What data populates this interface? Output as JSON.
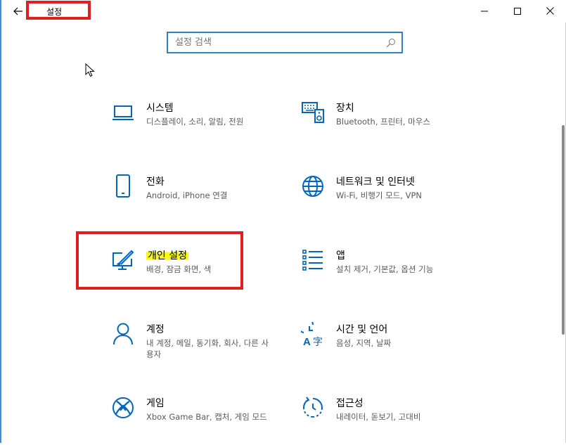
{
  "window": {
    "title": "설정",
    "minimize_label": "Minimize",
    "maximize_label": "Maximize",
    "close_label": "Close"
  },
  "search": {
    "placeholder": "설정 검색"
  },
  "colors": {
    "accent": "#0067c0",
    "annotation_red": "#e02020",
    "highlight_yellow": "#f7f71a"
  },
  "tiles": [
    {
      "id": "system",
      "title": "시스템",
      "desc": "디스플레이, 소리, 알림, 전원",
      "icon": "laptop-icon"
    },
    {
      "id": "devices",
      "title": "장치",
      "desc": "Bluetooth, 프린터, 마우스",
      "icon": "keyboard-speaker-icon"
    },
    {
      "id": "phone",
      "title": "전화",
      "desc": "Android, iPhone 연결",
      "icon": "phone-icon"
    },
    {
      "id": "network",
      "title": "네트워크 및 인터넷",
      "desc": "Wi-Fi, 비행기 모드, VPN",
      "icon": "globe-icon"
    },
    {
      "id": "personalization",
      "title": "개인 설정",
      "desc": "배경, 잠금 화면, 색",
      "icon": "paint-screen-icon"
    },
    {
      "id": "apps",
      "title": "앱",
      "desc": "설치 제거, 기본값, 옵션 기능",
      "icon": "app-list-icon"
    },
    {
      "id": "accounts",
      "title": "계정",
      "desc": "내 계정, 메일, 동기화, 회사, 다른 사용자",
      "icon": "person-icon"
    },
    {
      "id": "time-language",
      "title": "시간 및 언어",
      "desc": "음성, 지역, 날짜",
      "icon": "time-language-icon"
    },
    {
      "id": "gaming",
      "title": "게임",
      "desc": "Xbox Game Bar, 캡처, 게임 모드",
      "icon": "xbox-icon"
    },
    {
      "id": "accessibility",
      "title": "접근성",
      "desc": "내레이터, 돋보기, 고대비",
      "icon": "ease-of-access-icon"
    }
  ]
}
